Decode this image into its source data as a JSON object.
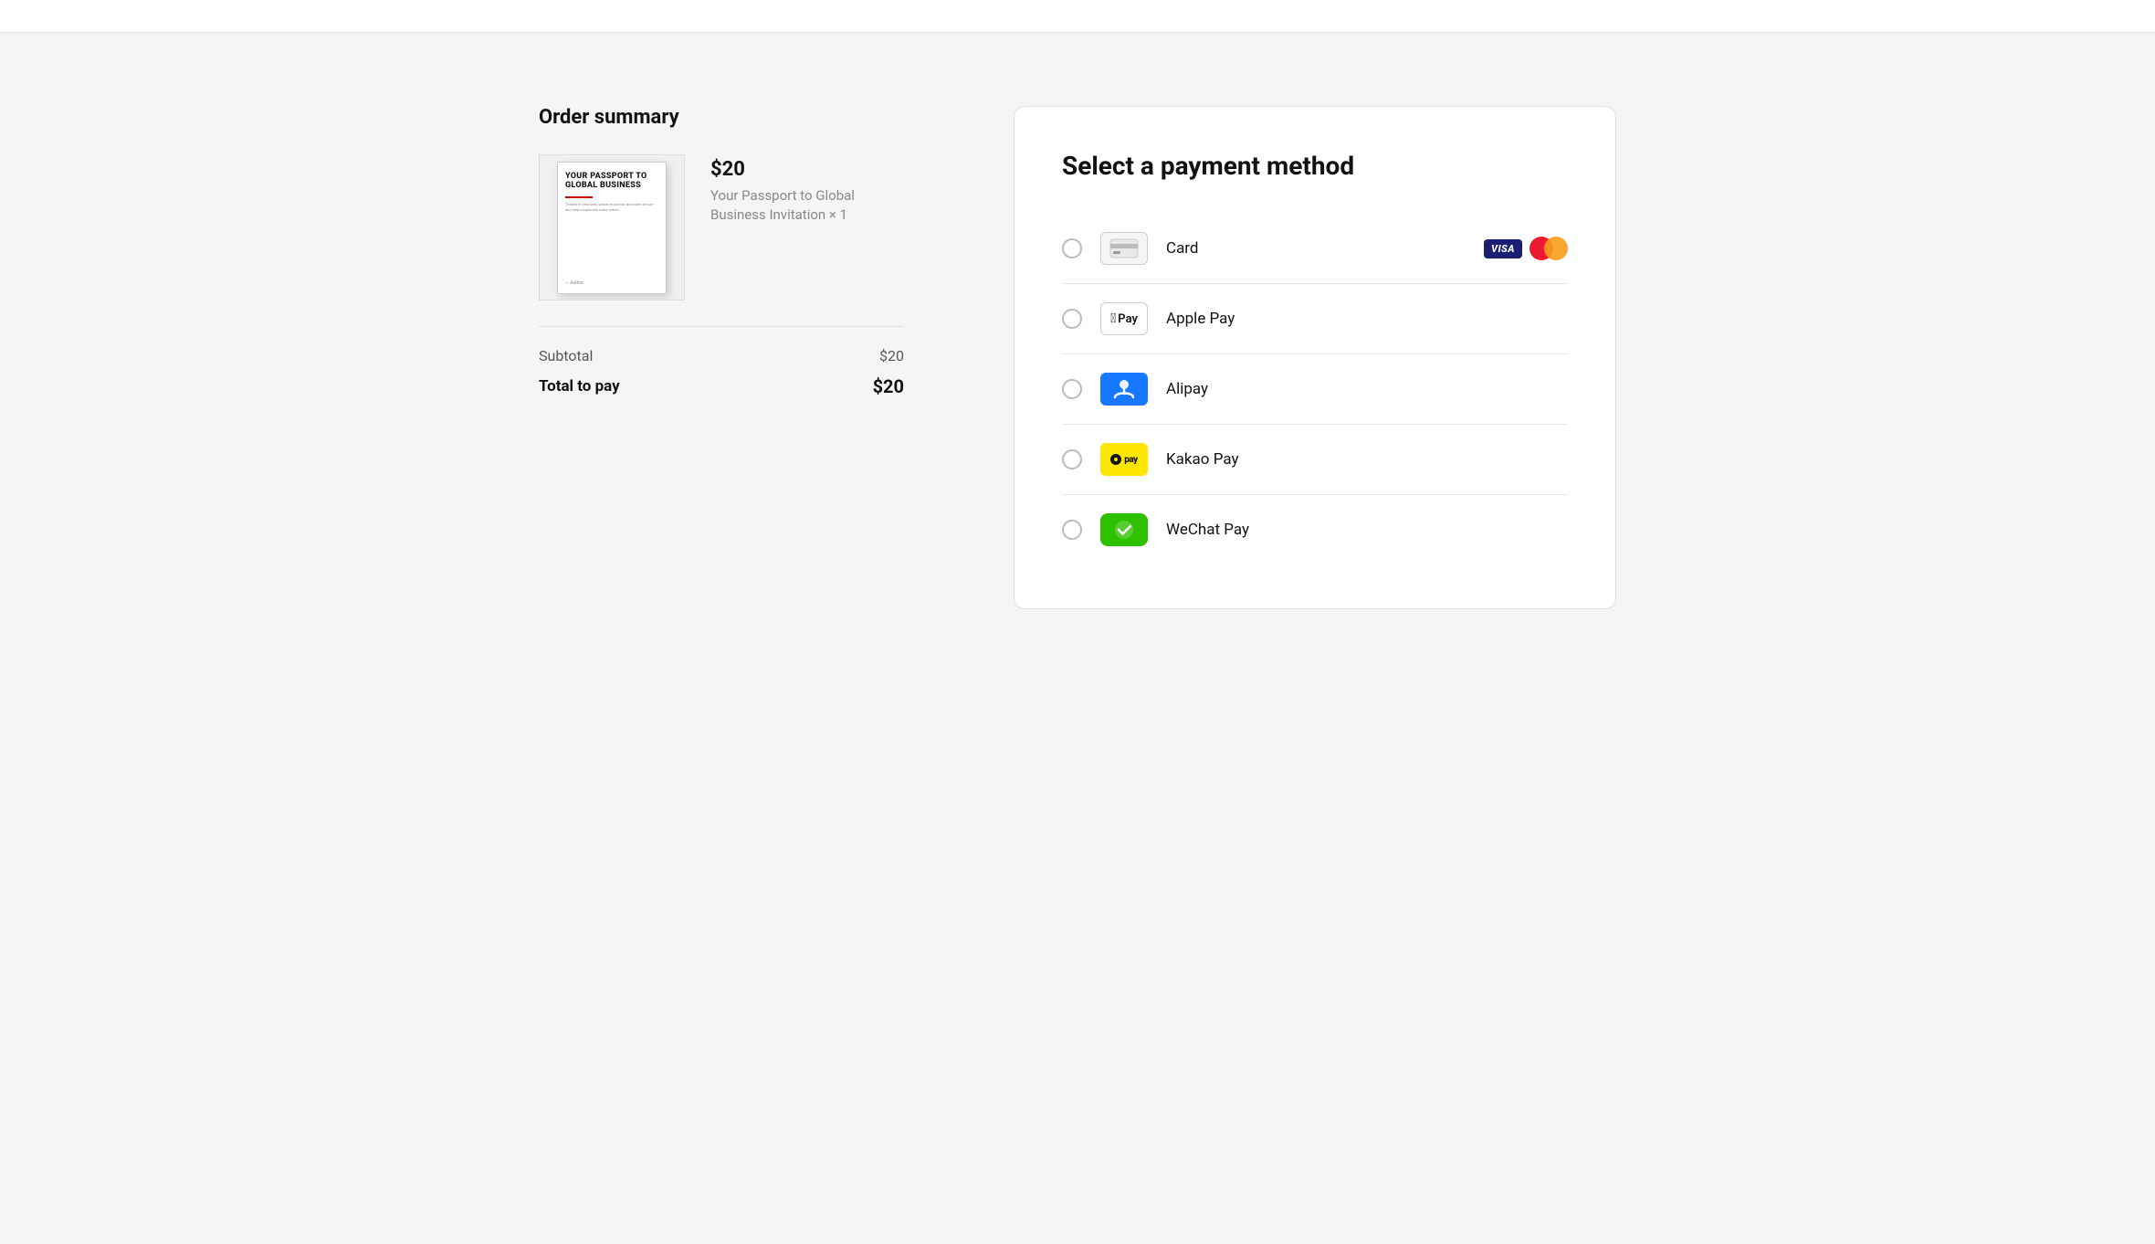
{
  "topbar": {},
  "order_summary": {
    "title": "Order summary",
    "product": {
      "price": "$20",
      "name": "Your Passport to Global Business Invitation × 1",
      "book_title": "YOUR PASSPORT TO GLOBAL BUSINESS"
    },
    "subtotal_label": "Subtotal",
    "subtotal_value": "$20",
    "total_label": "Total to pay",
    "total_value": "$20"
  },
  "payment": {
    "title": "Select a payment method",
    "methods": [
      {
        "id": "card",
        "label": "Card",
        "icon_type": "card",
        "has_badges": true
      },
      {
        "id": "applepay",
        "label": "Apple Pay",
        "icon_type": "applepay",
        "has_badges": false
      },
      {
        "id": "alipay",
        "label": "Alipay",
        "icon_type": "alipay",
        "has_badges": false
      },
      {
        "id": "kakaopay",
        "label": "Kakao Pay",
        "icon_type": "kakao",
        "has_badges": false
      },
      {
        "id": "wechatpay",
        "label": "WeChat Pay",
        "icon_type": "wechat",
        "has_badges": false
      }
    ]
  }
}
